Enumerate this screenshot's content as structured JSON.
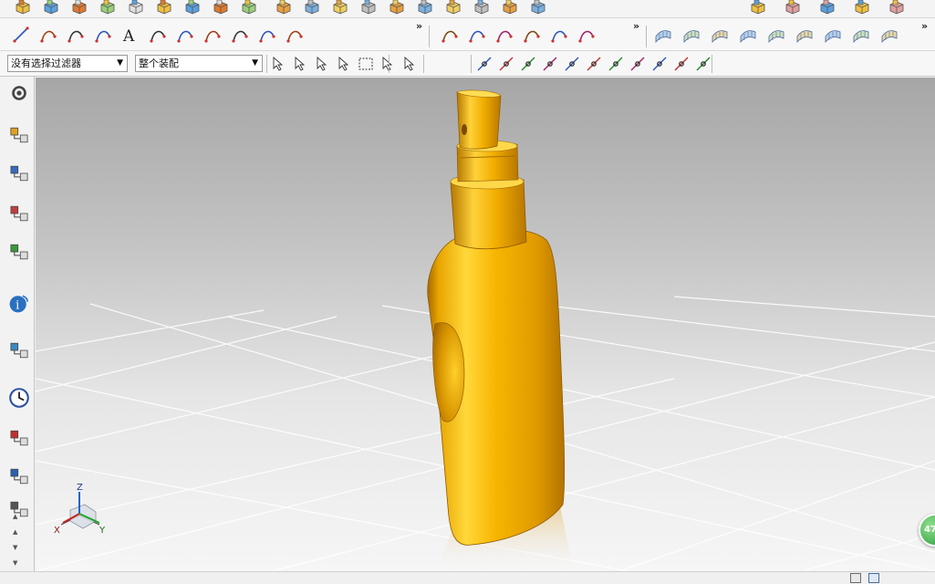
{
  "toolbar": {
    "row1_icons": [
      "block-icon",
      "extrude-icon",
      "revolve-icon",
      "hole-icon",
      "boss-icon",
      "blend-icon",
      "chamfer-icon",
      "shell-icon",
      "pattern-icon",
      "unite-icon",
      "trim-body-icon",
      "split-body-icon",
      "offset-face-icon",
      "thicken-icon",
      "draft-icon",
      "mirror-icon",
      "sew-icon",
      "move-face-icon",
      "replace-face-icon",
      "delete-face-icon",
      "sync-modeling-icon",
      "surface-icon",
      "mesh-surface-icon",
      "snap-icon"
    ],
    "row2_icons": [
      "line-icon",
      "arc-icon",
      "circle-icon",
      "spline-icon",
      "text-icon",
      "fillet-curve-icon",
      "offset-curve-icon",
      "bridge-curve-icon",
      "project-curve-icon",
      "curve-on-surface-icon",
      "wrap-curve-icon"
    ],
    "row2b_icons": [
      "point-icon",
      "trim-curve-icon",
      "split-curve-icon",
      "join-curve-icon",
      "divide-curve-icon",
      "edit-curve-icon"
    ],
    "row2c_icons": [
      "through-curves-icon",
      "ruled-surface-icon",
      "through-curve-mesh-icon",
      "swept-icon",
      "n-sided-surface-icon",
      "offset-surface-icon",
      "bridge-surface-icon",
      "studio-surface-icon",
      "face-blend-icon"
    ],
    "more_label": "»",
    "filter_combo": {
      "value": "没有选择过滤器"
    },
    "scope_combo": {
      "value": "整个装配"
    },
    "row3_icons": [
      "select-features-icon",
      "deselect-icon",
      "select-body-icon",
      "select-face-icon",
      "rect-select-icon",
      "body-select-icon",
      "solid-body-icon",
      "endpoint-snap-icon",
      "midpoint-snap-icon",
      "control-point-snap-icon",
      "curve-snap-icon",
      "intersection-snap-icon",
      "tangent-snap-icon",
      "center-snap-icon",
      "quadrant-snap-icon",
      "point-on-curve-snap-icon",
      "point-on-face-snap-icon",
      "grid-snap-icon"
    ]
  },
  "left_panel": {
    "icons": [
      "settings-icon",
      "assembly-navigator-icon",
      "constraint-navigator-icon",
      "part-navigator-icon",
      "reuse-library-icon",
      "info-icon",
      "hd3d-icon",
      "history-icon",
      "system-materials-icon",
      "process-studio-icon",
      "roles-icon"
    ]
  },
  "viewport": {
    "axis_labels": {
      "x": "X",
      "y": "Y",
      "z": "Z"
    },
    "floating_button": "47",
    "colors": {
      "bottle_light": "#ffd22a",
      "bottle_mid": "#f4a800",
      "bottle_dark": "#b87400",
      "grid": "#ffffff"
    }
  }
}
